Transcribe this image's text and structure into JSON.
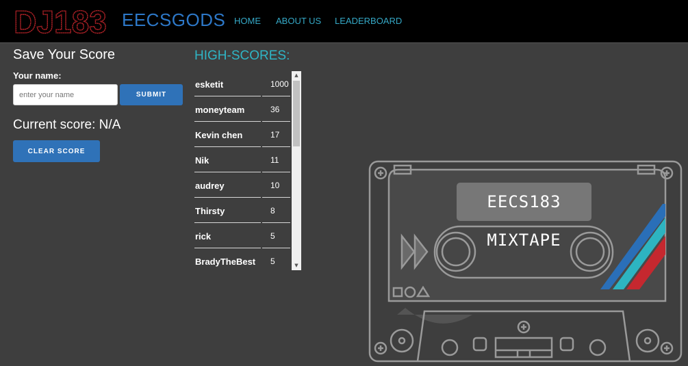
{
  "nav": {
    "logo_text": "DJ183",
    "brand": "EECSGODS",
    "links": [
      "HOME",
      "ABOUT US",
      "LEADERBOARD"
    ]
  },
  "save": {
    "title": "Save Your Score",
    "name_label": "Your name:",
    "name_placeholder": "enter your name",
    "name_value": "",
    "submit_label": "SUBMIT",
    "current_score": "Current score: N/A",
    "clear_label": "CLEAR SCORE"
  },
  "highscores": {
    "title": "HIGH-SCORES:",
    "rows": [
      {
        "name": "esketit",
        "score": "1000"
      },
      {
        "name": "moneyteam",
        "score": "36"
      },
      {
        "name": "Kevin chen",
        "score": "17"
      },
      {
        "name": "Nik",
        "score": "11"
      },
      {
        "name": "audrey",
        "score": "10"
      },
      {
        "name": "Thirsty",
        "score": "8"
      },
      {
        "name": "rick",
        "score": "5"
      },
      {
        "name": "BradyTheBest",
        "score": "5"
      }
    ]
  },
  "cassette": {
    "label": "EECS183 MIXTAPE"
  },
  "colors": {
    "logo_red": "#c9262c",
    "brand_blue": "#2d78c8",
    "nav_teal": "#35a8c6",
    "button_blue": "#2f72b8",
    "stripe_blue": "#2a6fb8",
    "stripe_teal": "#2db4c1",
    "stripe_red": "#c5282f"
  }
}
